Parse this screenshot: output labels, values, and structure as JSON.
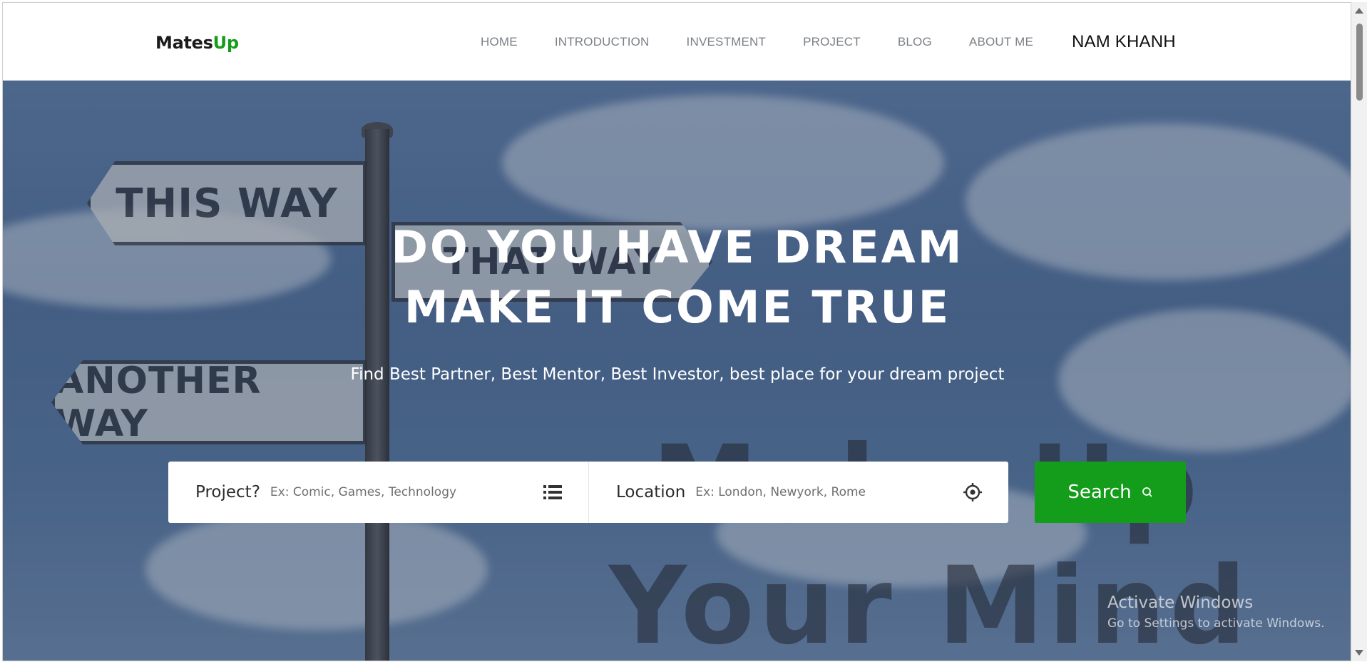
{
  "header": {
    "logo_main": "Mates",
    "logo_accent": "Up",
    "nav": [
      "HOME",
      "INTRODUCTION",
      "INVESTMENT",
      "PROJECT",
      "BLOG",
      "ABOUT ME"
    ],
    "user_name": "NAM KHANH"
  },
  "hero": {
    "title_line1": "DO YOU HAVE DREAM",
    "title_line2": "MAKE IT COME TRUE",
    "subtitle": "Find Best Partner, Best Mentor, Best Investor, best place for your dream project",
    "signs": [
      "THIS WAY",
      "THAT WAY",
      "ANOTHER WAY"
    ],
    "background_text": [
      "Make Up",
      "Your Mind"
    ]
  },
  "search": {
    "project_label": "Project?",
    "project_placeholder": "Ex: Comic, Games, Technology",
    "project_icon": "list-icon",
    "location_label": "Location",
    "location_placeholder": "Ex: London, Newyork, Rome",
    "location_icon": "crosshair-icon",
    "button_label": "Search",
    "button_icon": "search-icon"
  },
  "windows_notice": {
    "title": "Activate Windows",
    "message": "Go to Settings to activate Windows."
  },
  "colors": {
    "accent": "#149c1b",
    "nav_text": "#7b7f86",
    "header_bg": "#ffffff"
  }
}
